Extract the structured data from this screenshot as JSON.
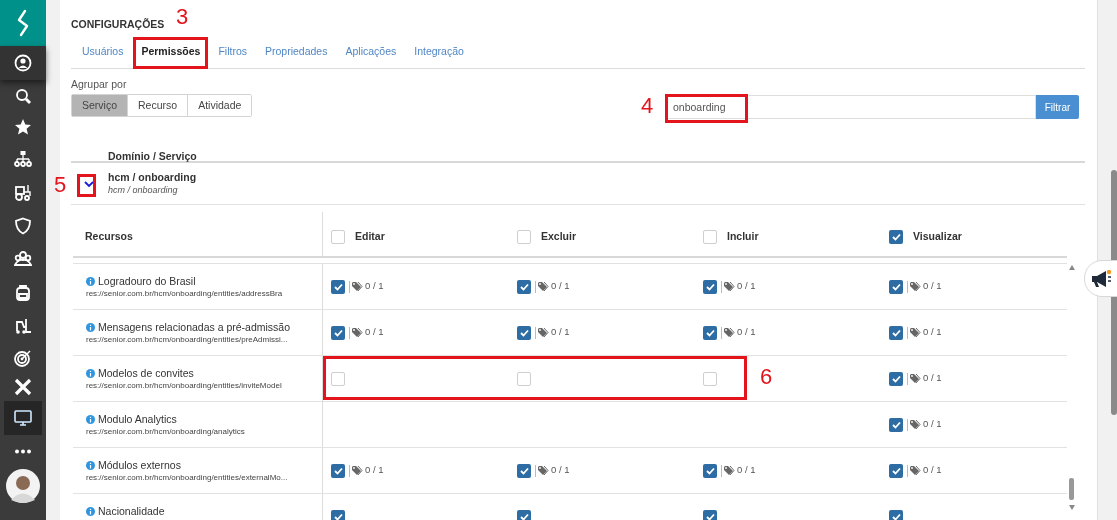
{
  "sidebar": {
    "items": [
      {
        "selected": false
      },
      {
        "selected": false
      },
      {
        "selected": false
      },
      {
        "selected": false
      },
      {
        "selected": false
      },
      {
        "selected": false
      },
      {
        "selected": false
      },
      {
        "selected": false
      },
      {
        "selected": false
      },
      {
        "selected": false
      },
      {
        "selected": false
      },
      {
        "selected": true
      },
      {
        "selected": false
      }
    ]
  },
  "page": {
    "title": "CONFIGURAÇÕES"
  },
  "tabs": [
    {
      "label": "Usuários",
      "selected": false
    },
    {
      "label": "Permissões",
      "selected": true
    },
    {
      "label": "Filtros",
      "selected": false
    },
    {
      "label": "Propriedades",
      "selected": false
    },
    {
      "label": "Aplicações",
      "selected": false
    },
    {
      "label": "Integração",
      "selected": false
    }
  ],
  "group_by": {
    "label": "Agrupar por",
    "options": [
      {
        "label": "Serviço",
        "selected": true
      },
      {
        "label": "Recurso",
        "selected": false
      },
      {
        "label": "Atividade",
        "selected": false
      }
    ]
  },
  "filter": {
    "value": "onboarding",
    "button": "Filtrar"
  },
  "domain_header": "Domínio / Serviço",
  "domain": {
    "name": "hcm / onboarding",
    "subtitle": "hcm / onboarding",
    "expanded": true
  },
  "resources": {
    "header": "Recursos",
    "columns": [
      {
        "label": "Editar",
        "checked": false
      },
      {
        "label": "Excluir",
        "checked": false
      },
      {
        "label": "Incluir",
        "checked": false
      },
      {
        "label": "Visualizar",
        "checked": true
      }
    ],
    "rows": [
      {
        "name": "Logradouro do Brasil",
        "path": "res://senior.com.br/hcm/onboarding/entities/addressBra",
        "cells": [
          {
            "kind": "checkbox",
            "checked": true,
            "tags": "0 / 1"
          },
          {
            "kind": "checkbox",
            "checked": true,
            "tags": "0 / 1"
          },
          {
            "kind": "checkbox",
            "checked": true,
            "tags": "0 / 1"
          },
          {
            "kind": "checkbox",
            "checked": true,
            "tags": "0 / 1"
          }
        ]
      },
      {
        "name": "Mensagens relacionadas a pré-admissão",
        "path": "res://senior.com.br/hcm/onboarding/entities/preAdmissi...",
        "cells": [
          {
            "kind": "checkbox",
            "checked": true,
            "tags": "0 / 1"
          },
          {
            "kind": "checkbox",
            "checked": true,
            "tags": "0 / 1"
          },
          {
            "kind": "checkbox",
            "checked": true,
            "tags": "0 / 1"
          },
          {
            "kind": "checkbox",
            "checked": true,
            "tags": "0 / 1"
          }
        ]
      },
      {
        "name": "Modelos de convites",
        "path": "res://senior.com.br/hcm/onboarding/entities/inviteModel",
        "cells": [
          {
            "kind": "checkbox",
            "checked": false
          },
          {
            "kind": "checkbox",
            "checked": false
          },
          {
            "kind": "checkbox",
            "checked": false
          },
          {
            "kind": "checkbox",
            "checked": true,
            "tags": "0 / 1"
          }
        ]
      },
      {
        "name": "Modulo Analytics",
        "path": "res://senior.com.br/hcm/onboarding/analytics",
        "cells": [
          {
            "kind": "none"
          },
          {
            "kind": "none"
          },
          {
            "kind": "none"
          },
          {
            "kind": "checkbox",
            "checked": true,
            "tags": "0 / 1"
          }
        ]
      },
      {
        "name": "Módulos externos",
        "path": "res://senior.com.br/hcm/onboarding/entities/externalMo...",
        "cells": [
          {
            "kind": "checkbox",
            "checked": true,
            "tags": "0 / 1"
          },
          {
            "kind": "checkbox",
            "checked": true,
            "tags": "0 / 1"
          },
          {
            "kind": "checkbox",
            "checked": true,
            "tags": "0 / 1"
          },
          {
            "kind": "checkbox",
            "checked": true,
            "tags": "0 / 1"
          }
        ]
      },
      {
        "name": "Nacionalidade",
        "cells": [
          {
            "kind": "checkbox",
            "checked": true
          },
          {
            "kind": "checkbox",
            "checked": true
          },
          {
            "kind": "checkbox",
            "checked": true
          },
          {
            "kind": "checkbox",
            "checked": true
          }
        ]
      }
    ]
  },
  "annotations": [
    {
      "label": "3"
    },
    {
      "label": "4"
    },
    {
      "label": "5"
    },
    {
      "label": "6"
    }
  ]
}
